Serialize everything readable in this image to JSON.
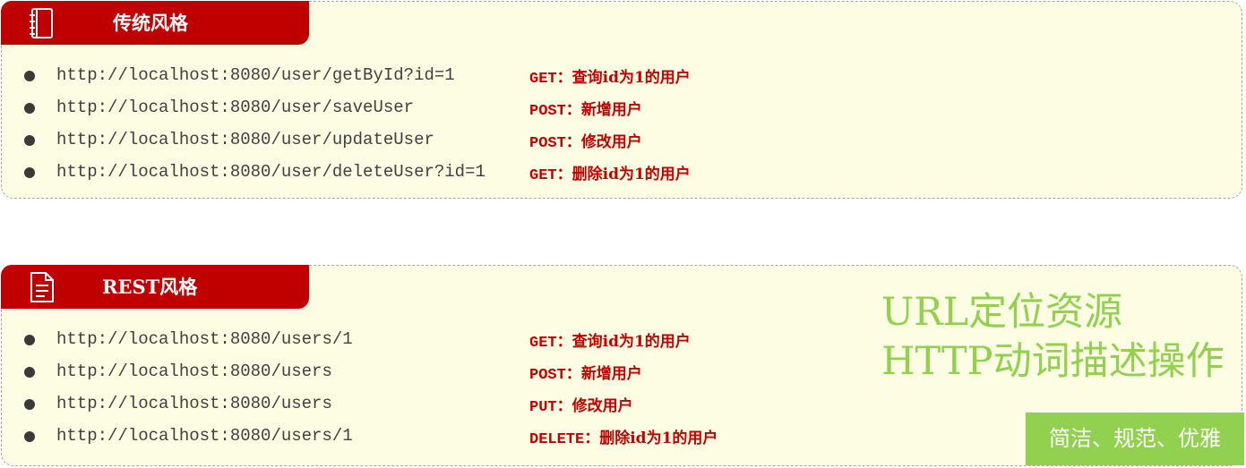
{
  "traditional": {
    "title": "传统风格",
    "icon": "notebook-icon",
    "rows": [
      {
        "url": "http://localhost:8080/user/getById?id=1",
        "method": "GET：",
        "description": "查询id为1的用户"
      },
      {
        "url": "http://localhost:8080/user/saveUser",
        "method": "POST：",
        "description": "新增用户"
      },
      {
        "url": "http://localhost:8080/user/updateUser",
        "method": "POST：",
        "description": "修改用户"
      },
      {
        "url": "http://localhost:8080/user/deleteUser?id=1",
        "method": "GET：",
        "description": "删除id为1的用户"
      }
    ]
  },
  "rest": {
    "title": "REST风格",
    "icon": "document-icon",
    "rows": [
      {
        "url": "http://localhost:8080/users/1",
        "method": "GET：",
        "description": "查询id为1的用户"
      },
      {
        "url": "http://localhost:8080/users",
        "method": "POST：",
        "description": "新增用户"
      },
      {
        "url": "http://localhost:8080/users",
        "method": "PUT：",
        "description": "修改用户"
      },
      {
        "url": "http://localhost:8080/users/1",
        "method": "DELETE：",
        "description": "删除id为1的用户"
      }
    ]
  },
  "note": {
    "line1": "URL定位资源",
    "line2": "HTTP动词描述操作"
  },
  "badge": {
    "text": "简洁、规范、优雅"
  },
  "colors": {
    "header_red": "#c00000",
    "panel_bg": "#fdfde3",
    "accent_green": "#92d050",
    "url_text": "#404040"
  }
}
